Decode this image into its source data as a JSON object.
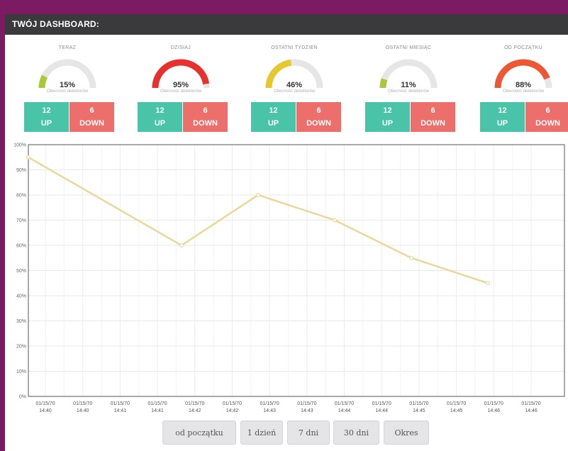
{
  "header": {
    "title": "TWÓJ DASHBOARD:"
  },
  "gauges": [
    {
      "title": "TERAZ",
      "percent": 15,
      "percent_label": "15%",
      "subtitle": "Obecność detektorów",
      "color": "#a8c93a",
      "up_count": "12",
      "up_label": "UP",
      "down_count": "6",
      "down_label": "DOWN"
    },
    {
      "title": "DZISIAJ",
      "percent": 95,
      "percent_label": "95%",
      "subtitle": "Obecność detektorów",
      "color": "#e8312d",
      "up_count": "12",
      "up_label": "UP",
      "down_count": "6",
      "down_label": "DOWN"
    },
    {
      "title": "OSTATNI TYDZIEŃ",
      "percent": 46,
      "percent_label": "46%",
      "subtitle": "Obecność detektorów",
      "color": "#e6c82e",
      "up_count": "12",
      "up_label": "UP",
      "down_count": "6",
      "down_label": "DOWN"
    },
    {
      "title": "OSTATNI MIESIĄC",
      "percent": 11,
      "percent_label": "11%",
      "subtitle": "Obecność detektorów",
      "color": "#a8c93a",
      "up_count": "12",
      "up_label": "UP",
      "down_count": "6",
      "down_label": "DOWN"
    },
    {
      "title": "OD POCZĄTKU",
      "percent": 88,
      "percent_label": "88%",
      "subtitle": "Obecność detektorów",
      "color": "#ee5733",
      "up_count": "12",
      "up_label": "UP",
      "down_count": "6",
      "down_label": "DOWN"
    }
  ],
  "colors": {
    "up": "#49c4a8",
    "down": "#ec6f6b",
    "line": "#ead79a",
    "gauge_track": "#e6e6e6"
  },
  "chart_data": {
    "type": "line",
    "ylim": [
      0,
      100
    ],
    "yticks": [
      "0%",
      "10%",
      "20%",
      "30%",
      "40%",
      "50%",
      "60%",
      "70%",
      "80%",
      "90%",
      "100%"
    ],
    "x_tick_labels": [
      [
        "01/15/70",
        "14:40"
      ],
      [
        "01/15/70",
        "14:40"
      ],
      [
        "01/15/70",
        "14:41"
      ],
      [
        "01/15/70",
        "14:41"
      ],
      [
        "01/15/70",
        "14:42"
      ],
      [
        "01/15/70",
        "14:42"
      ],
      [
        "01/15/70",
        "14:43"
      ],
      [
        "01/15/70",
        "14:43"
      ],
      [
        "01/15/70",
        "14:44"
      ],
      [
        "01/15/70",
        "14:44"
      ],
      [
        "01/15/70",
        "14:45"
      ],
      [
        "01/15/70",
        "14:45"
      ],
      [
        "01/15/70",
        "14:46"
      ],
      [
        "01/15/70",
        "14:46"
      ]
    ],
    "x": [
      "14:39:30",
      "14:41:30",
      "14:42:30",
      "14:43:30",
      "14:44:30",
      "14:45:30"
    ],
    "series": [
      {
        "values": [
          95,
          60,
          80,
          70,
          55,
          45
        ]
      }
    ],
    "grid": true
  },
  "range_buttons": [
    "od początku",
    "1 dzień",
    "7 dni",
    "30 dni",
    "Okres"
  ]
}
